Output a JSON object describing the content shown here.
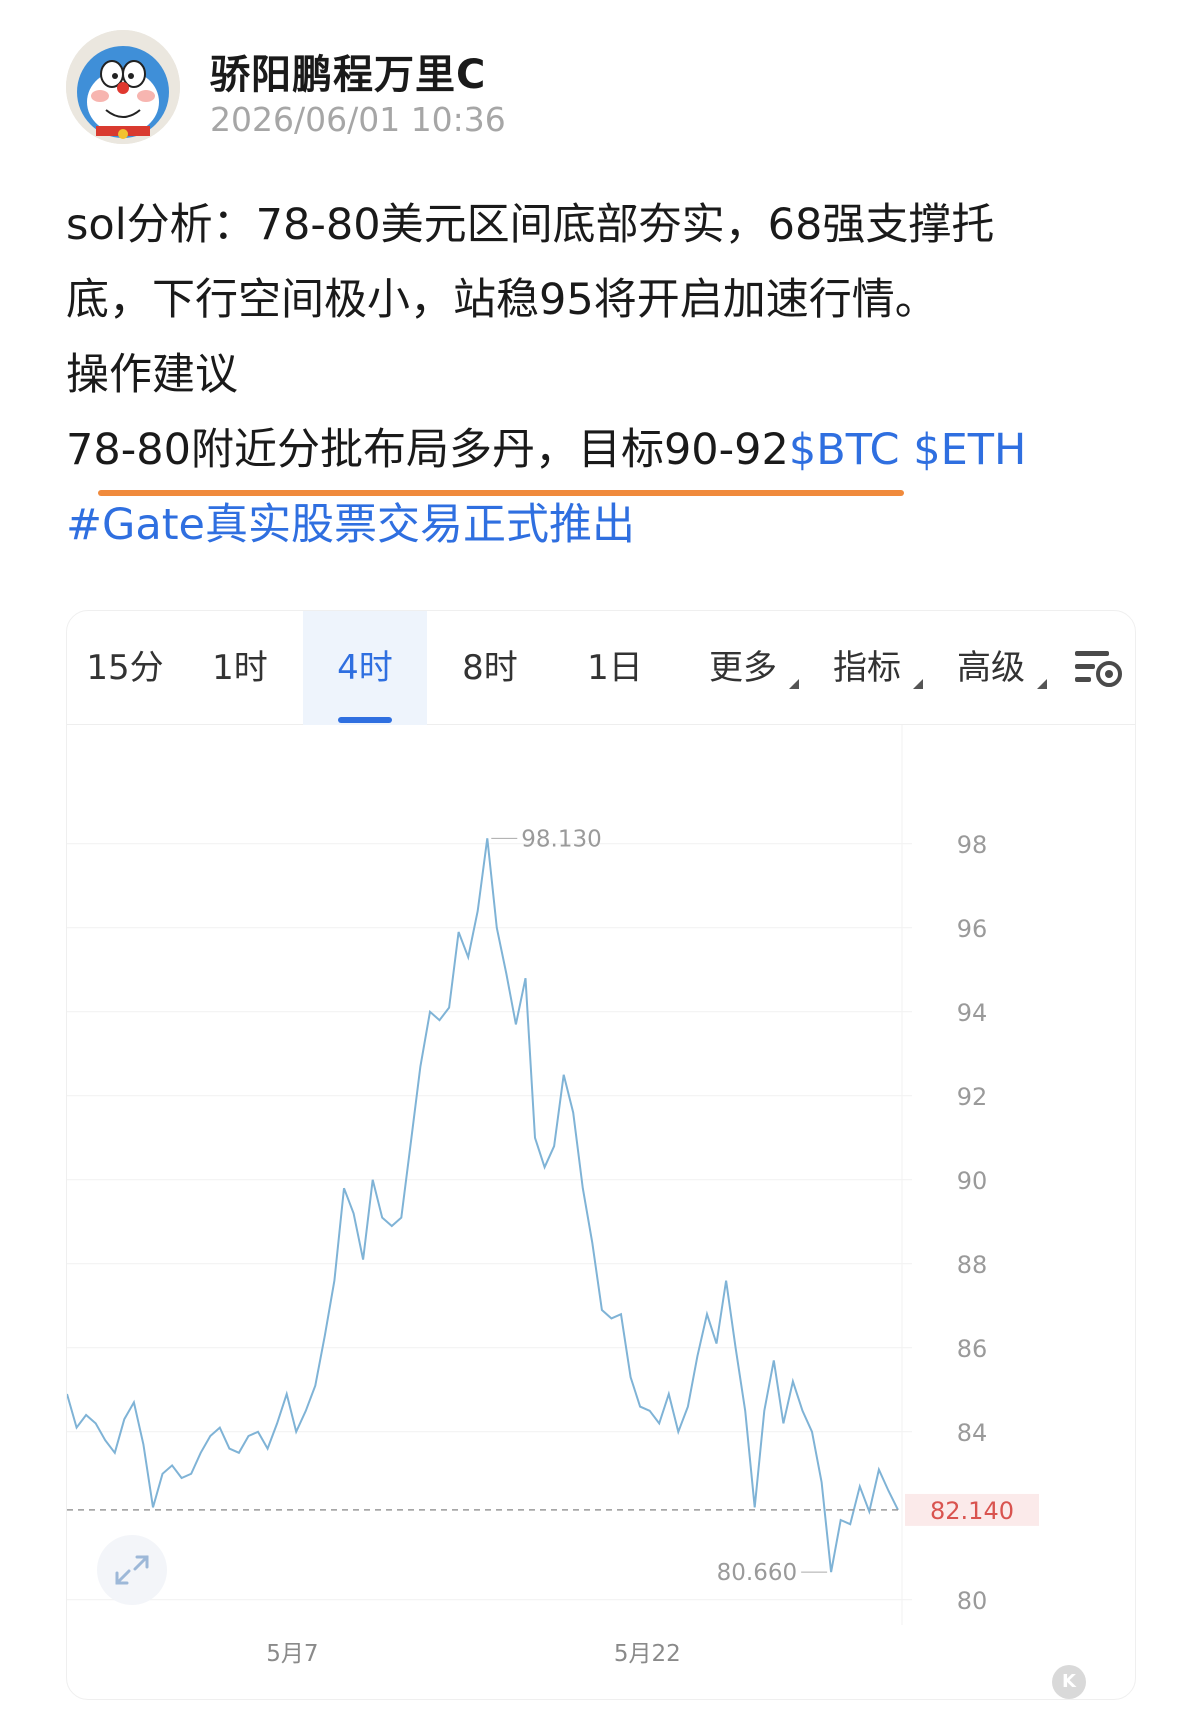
{
  "post": {
    "author": "骄阳鹏程万里C",
    "timestamp": "2026/06/01 10:36",
    "line1": "sol分析：78-80美元区间底部夯实，68强支撑托",
    "line2": "底，下行空间极小，站稳95将开启加速行情。",
    "line3": "操作建议",
    "line4_text": "78-80附近分批布局多丹，目标90-92",
    "tag_btc": "$BTC",
    "tag_eth": "$ETH",
    "hashtag": "#Gate真实股票交易正式推出"
  },
  "chart_card": {
    "tabs": [
      {
        "label": "15分",
        "active": false
      },
      {
        "label": "1时",
        "active": false
      },
      {
        "label": "4时",
        "active": true
      },
      {
        "label": "8时",
        "active": false
      },
      {
        "label": "1日",
        "active": false
      },
      {
        "label": "更多",
        "active": false
      },
      {
        "label": "指标",
        "active": false
      },
      {
        "label": "高级",
        "active": false
      }
    ],
    "settings_icon": "chart-settings-icon",
    "expand_icon": "expand-icon",
    "badge_text": "K"
  },
  "colors": {
    "accent": "#2f6fe0",
    "line": "#7fb3d6",
    "price_label": "#d9534f",
    "underline": "#f08a3c"
  },
  "chart_data": {
    "type": "line",
    "title": "",
    "xlabel": "",
    "ylabel": "",
    "x_ticks": [
      "5月7",
      "5月22"
    ],
    "y_ticks": [
      80,
      84,
      86,
      88,
      90,
      92,
      94,
      96,
      98
    ],
    "ylim": [
      79.4,
      99.4
    ],
    "grid": true,
    "current_price": "82.140",
    "high_label": "98.130",
    "low_label": "80.660",
    "series": [
      {
        "values": [
          84.9,
          84.1,
          84.4,
          84.2,
          83.8,
          83.5,
          84.3,
          84.7,
          83.7,
          82.2,
          83.0,
          83.2,
          82.9,
          83.0,
          83.5,
          83.9,
          84.1,
          83.6,
          83.5,
          83.9,
          84.0,
          83.6,
          84.2,
          84.9,
          84.0,
          84.5,
          85.1,
          86.3,
          87.6,
          89.8,
          89.2,
          88.1,
          90.0,
          89.1,
          88.9,
          89.1,
          90.9,
          92.7,
          94.0,
          93.8,
          94.1,
          95.9,
          95.3,
          96.4,
          98.13,
          96.0,
          94.9,
          93.7,
          94.8,
          91.0,
          90.3,
          90.8,
          92.5,
          91.6,
          89.8,
          88.5,
          86.9,
          86.7,
          86.8,
          85.3,
          84.6,
          84.5,
          84.2,
          84.9,
          84.0,
          84.6,
          85.8,
          86.8,
          86.1,
          87.6,
          86.0,
          84.5,
          82.2,
          84.5,
          85.7,
          84.2,
          85.2,
          84.5,
          84.0,
          82.8,
          80.66,
          81.9,
          81.8,
          82.7,
          82.1,
          83.1,
          82.6,
          82.14
        ]
      }
    ]
  }
}
